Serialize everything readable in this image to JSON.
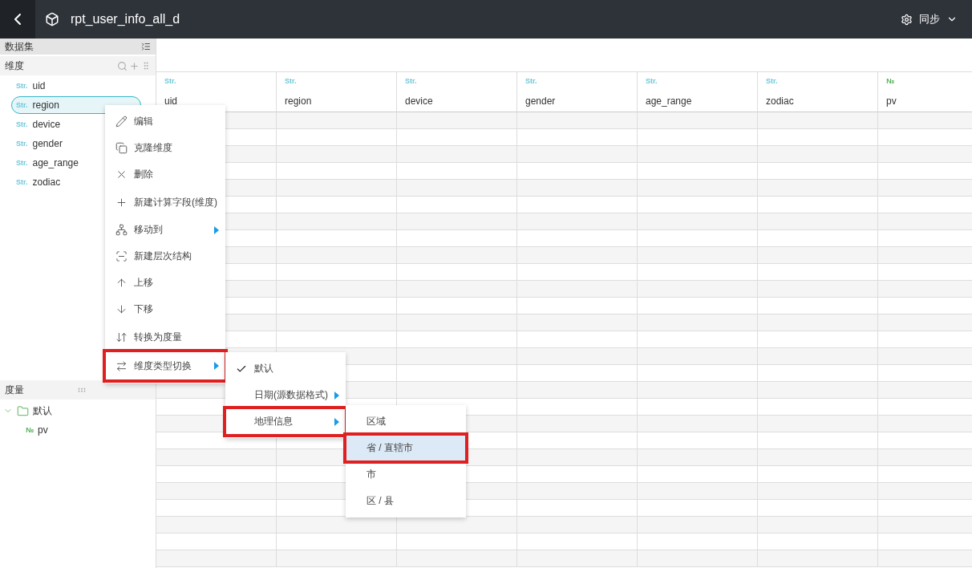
{
  "header": {
    "title": "rpt_user_info_all_d",
    "sync_label": "同步"
  },
  "sidebar": {
    "title": "数据集",
    "dimensions": {
      "title": "维度",
      "items": [
        {
          "type": "Str.",
          "kind": "str",
          "name": "uid",
          "selected": false
        },
        {
          "type": "Str.",
          "kind": "str",
          "name": "region",
          "selected": true
        },
        {
          "type": "Str.",
          "kind": "str",
          "name": "device",
          "selected": false
        },
        {
          "type": "Str.",
          "kind": "str",
          "name": "gender",
          "selected": false
        },
        {
          "type": "Str.",
          "kind": "str",
          "name": "age_range",
          "selected": false
        },
        {
          "type": "Str.",
          "kind": "str",
          "name": "zodiac",
          "selected": false
        }
      ]
    },
    "measures": {
      "title": "度量",
      "folders": [
        {
          "name": "默认",
          "expanded": true,
          "children": [
            {
              "type": "№",
              "kind": "num",
              "name": "pv"
            }
          ]
        }
      ]
    }
  },
  "table": {
    "columns": [
      {
        "type": "Str.",
        "kind": "str",
        "name": "uid"
      },
      {
        "type": "Str.",
        "kind": "str",
        "name": "region"
      },
      {
        "type": "Str.",
        "kind": "str",
        "name": "device"
      },
      {
        "type": "Str.",
        "kind": "str",
        "name": "gender"
      },
      {
        "type": "Str.",
        "kind": "str",
        "name": "age_range"
      },
      {
        "type": "Str.",
        "kind": "str",
        "name": "zodiac"
      },
      {
        "type": "№",
        "kind": "num",
        "name": "pv"
      }
    ]
  },
  "context_menu": {
    "items": [
      {
        "label": "编辑",
        "has_submenu": false,
        "annotated": false
      },
      {
        "label": "克隆维度",
        "has_submenu": false,
        "annotated": false
      },
      {
        "label": "删除",
        "has_submenu": false,
        "annotated": false
      },
      {
        "label": "新建计算字段(维度)",
        "has_submenu": false,
        "annotated": false
      },
      {
        "label": "移动到",
        "has_submenu": true,
        "annotated": false
      },
      {
        "label": "新建层次结构",
        "has_submenu": false,
        "annotated": false
      },
      {
        "label": "上移",
        "has_submenu": false,
        "annotated": false
      },
      {
        "label": "下移",
        "has_submenu": false,
        "annotated": false
      },
      {
        "label": "转换为度量",
        "has_submenu": false,
        "annotated": false
      },
      {
        "label": "维度类型切换",
        "has_submenu": true,
        "annotated": true
      }
    ]
  },
  "type_submenu": {
    "items": [
      {
        "label": "默认",
        "checked": true,
        "has_submenu": false,
        "annotated": false
      },
      {
        "label": "日期(源数据格式)",
        "checked": false,
        "has_submenu": true,
        "annotated": false
      },
      {
        "label": "地理信息",
        "checked": false,
        "has_submenu": true,
        "annotated": true
      }
    ]
  },
  "geo_submenu": {
    "items": [
      {
        "label": "区域",
        "selected": false,
        "annotated": false
      },
      {
        "label": "省 / 直辖市",
        "selected": true,
        "annotated": true
      },
      {
        "label": "市",
        "selected": false,
        "annotated": false
      },
      {
        "label": "区 / 县",
        "selected": false,
        "annotated": false
      }
    ]
  }
}
